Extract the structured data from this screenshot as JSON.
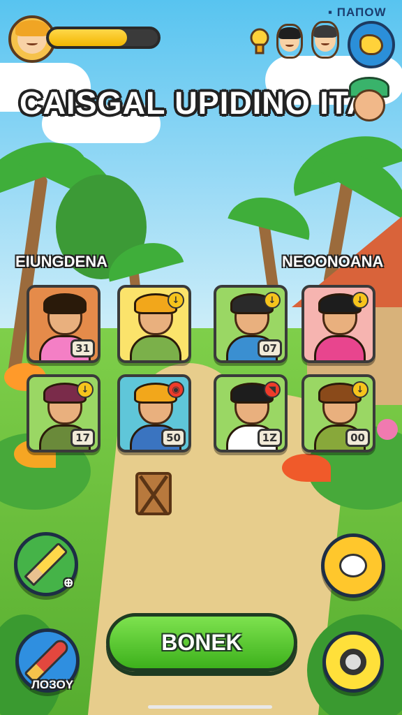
{
  "status_bar": {
    "text": "▪ ПАПОW"
  },
  "hud": {
    "player_avatar_icon": "player-avatar-icon",
    "progress": 0.72,
    "progress_color": "#f2b600",
    "top_icons": [
      "trophy-icon",
      "villager-1-icon",
      "villager-2-icon"
    ],
    "map_icon": "map-icon"
  },
  "title": "CAISGAL UPIDINO ITA",
  "guide_avatar_icon": "guide-avatar-icon",
  "sections": {
    "left_label": "EIUNGDENA",
    "right_label": "NEOONOANA"
  },
  "cards": [
    {
      "level": "31",
      "bg": "#e58b4a",
      "hair": "#2a1a0a",
      "body": "#f47fc5",
      "badge": ""
    },
    {
      "level": "",
      "bg": "#fbe36b",
      "hair": "#f2a71b",
      "body": "#7bb04a",
      "badge": "↓"
    },
    {
      "level": "07",
      "bg": "#9ad764",
      "hair": "#2a2a2a",
      "body": "#3a8fd1",
      "badge": "↓"
    },
    {
      "level": "",
      "bg": "#f6b4b0",
      "hair": "#1d1d1d",
      "body": "#e8458e",
      "badge": "↓"
    },
    {
      "level": "17",
      "bg": "#9ad764",
      "hair": "#7a2b4a",
      "body": "#6a8a3a",
      "badge": "↓"
    },
    {
      "level": "50",
      "bg": "#5fc6d9",
      "hair": "#f2a71b",
      "body": "#3a74c0",
      "badge": "◉"
    },
    {
      "level": "1Z",
      "bg": "#9ad764",
      "hair": "#1d1d1d",
      "body": "#ffffff",
      "badge": "◥"
    },
    {
      "level": "00",
      "bg": "#9ad764",
      "hair": "#8a4a1a",
      "body": "#88a83a",
      "badge": "↓"
    }
  ],
  "buttons": {
    "edit_sub_label": "⊕",
    "launch_sub_label": "ЛОЗОY",
    "main_label": "BONEK",
    "chat_icon": "chat-bubble-icon",
    "search_icon": "search-icon"
  }
}
